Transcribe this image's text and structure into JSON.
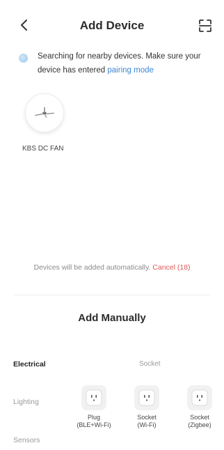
{
  "header": {
    "title": "Add Device",
    "back_icon": "chevron-left-icon",
    "scan_icon": "scan-icon"
  },
  "searching": {
    "message": "Searching for nearby devices. Make sure your device has entered",
    "link": "pairing mode",
    "spinner_icon": "spinner-icon"
  },
  "devices": [
    {
      "name": "KBS DC FAN",
      "icon": "ceiling-fan-icon"
    }
  ],
  "auto_add": {
    "message": "Devices will be added automatically.",
    "cancel_label": "Cancel (18)",
    "cancel_color": "#e05a55"
  },
  "manual": {
    "title": "Add Manually",
    "categories": [
      {
        "label": "Electrical",
        "active": true
      },
      {
        "label": "Lighting",
        "active": false
      },
      {
        "label": "Sensors",
        "active": false
      }
    ],
    "section_title": "Socket",
    "products": [
      {
        "line1": "Plug",
        "line2": "(BLE+Wi-Fi)",
        "icon": "socket-icon"
      },
      {
        "line1": "Socket",
        "line2": "(Wi-Fi)",
        "icon": "socket-icon"
      },
      {
        "line1": "Socket",
        "line2": "(Zigbee)",
        "icon": "socket-icon"
      }
    ]
  },
  "colors": {
    "link_blue": "#3b86d6",
    "cancel_red": "#e05a55"
  }
}
